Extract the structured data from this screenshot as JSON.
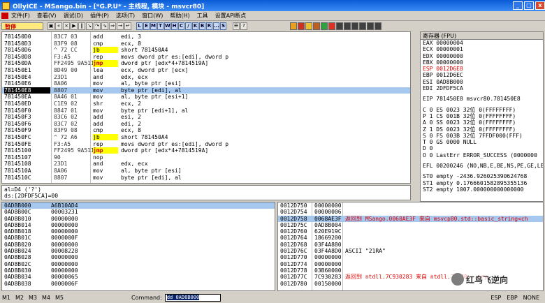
{
  "title": "OllyICE - MSango.bin - [*G.P.U* - 主线程, 模块 - msvcr80]",
  "window_buttons": [
    "_",
    "□",
    "x"
  ],
  "menu": [
    "文件(F)",
    "查看(V)",
    "调试(D)",
    "插件(P)",
    "选项(T)",
    "窗口(W)",
    "帮助(H)",
    "工具",
    "设置API断点"
  ],
  "toolbar": {
    "pause_label": "暂停",
    "letters": [
      "L",
      "E",
      "M",
      "T",
      "W",
      "H",
      "C",
      "/",
      "K",
      "B",
      "R",
      "...",
      "S"
    ]
  },
  "disasm": [
    {
      "addr": "781450D0",
      "hex": "83C7 03",
      "mnem": "add",
      "ops": "edi, 3",
      "style": ""
    },
    {
      "addr": "781450D3",
      "hex": "83F9 08",
      "mnem": "cmp",
      "ops": "ecx, 8",
      "style": ""
    },
    {
      "addr": "781450D6",
      "hex": "^ 72 CC",
      "mnem": "jb",
      "ops": "short 781450A4",
      "style": "hl"
    },
    {
      "addr": "781450D8",
      "hex": "F3:A5",
      "mnem": "rep",
      "ops": "movs dword ptr es:[edi], dword p",
      "style": ""
    },
    {
      "addr": "781450DA",
      "hex": "FF2495 9A51147",
      "mnem": "jmp",
      "ops": "dword ptr [edx*4+7814519A]",
      "style": "jmp"
    },
    {
      "addr": "781450E1",
      "hex": "8D49 00",
      "mnem": "lea",
      "ops": "ecx, dword ptr [ecx]",
      "style": ""
    },
    {
      "addr": "781450E4",
      "hex": "23D1",
      "mnem": "and",
      "ops": "edx, ecx",
      "style": ""
    },
    {
      "addr": "781450E6",
      "hex": "8A06",
      "mnem": "mov",
      "ops": "al, byte ptr [esi]",
      "style": ""
    },
    {
      "addr": "781450E8",
      "hex": "8807",
      "mnem": "mov",
      "ops": "byte ptr [edi], al",
      "style": "",
      "selected": true
    },
    {
      "addr": "781450EA",
      "hex": "8A46 01",
      "mnem": "mov",
      "ops": "al, byte ptr [esi+1]",
      "style": ""
    },
    {
      "addr": "781450ED",
      "hex": "C1E9 02",
      "mnem": "shr",
      "ops": "ecx, 2",
      "style": ""
    },
    {
      "addr": "781450F0",
      "hex": "8847 01",
      "mnem": "mov",
      "ops": "byte ptr [edi+1], al",
      "style": ""
    },
    {
      "addr": "781450F3",
      "hex": "83C6 02",
      "mnem": "add",
      "ops": "esi, 2",
      "style": ""
    },
    {
      "addr": "781450F6",
      "hex": "83C7 02",
      "mnem": "add",
      "ops": "edi, 2",
      "style": ""
    },
    {
      "addr": "781450F9",
      "hex": "83F9 08",
      "mnem": "cmp",
      "ops": "ecx, 8",
      "style": ""
    },
    {
      "addr": "781450FC",
      "hex": "^ 72 A6",
      "mnem": "jb",
      "ops": "short 781450A4",
      "style": "hl"
    },
    {
      "addr": "781450FE",
      "hex": "F3:A5",
      "mnem": "rep",
      "ops": "movs dword ptr es:[edi], dword p",
      "style": ""
    },
    {
      "addr": "78145100",
      "hex": "FF2495 9A51147",
      "mnem": "jmp",
      "ops": "dword ptr [edx*4+7814519A]",
      "style": "jmp"
    },
    {
      "addr": "78145107",
      "hex": "90",
      "mnem": "nop",
      "ops": "",
      "style": ""
    },
    {
      "addr": "78145108",
      "hex": "23D1",
      "mnem": "and",
      "ops": "edx, ecx",
      "style": ""
    },
    {
      "addr": "7814510A",
      "hex": "8A06",
      "mnem": "mov",
      "ops": "al, byte ptr [esi]",
      "style": ""
    },
    {
      "addr": "7814510C",
      "hex": "8807",
      "mnem": "mov",
      "ops": "byte ptr [edi], al",
      "style": ""
    }
  ],
  "registers": {
    "header": "寄存器 (FPU)",
    "lines": [
      {
        "t": "EAX 00000004",
        "red": false
      },
      {
        "t": "ECX 00000001",
        "red": false
      },
      {
        "t": "EDX 00000000",
        "red": false
      },
      {
        "t": "EBX 00000000",
        "red": false
      },
      {
        "t": "ESP 0012D6E8",
        "red": true
      },
      {
        "t": "EBP 0012D6EC",
        "red": false
      },
      {
        "t": "ESI 0AD8B000",
        "red": false
      },
      {
        "t": "EDI 2DFDF5CA",
        "red": false
      },
      {
        "t": "",
        "red": false,
        "gap": true
      },
      {
        "t": "EIP 781450E8 msvcr80.781450E8",
        "red": false
      },
      {
        "t": "",
        "red": false,
        "gap": true
      },
      {
        "t": "C 0  ES 0023 32位 0(FFFFFFFF)",
        "red": false
      },
      {
        "t": "P 1  CS 001B 32位 0(FFFFFFFF)",
        "red": false
      },
      {
        "t": "A 0  SS 0023 32位 0(FFFFFFFF)",
        "red": false
      },
      {
        "t": "Z 1  DS 0023 32位 0(FFFFFFFF)",
        "red": false
      },
      {
        "t": "S 0  FS 003B 32位 7FFDF000(FFF)",
        "red": false
      },
      {
        "t": "T 0  GS 0000 NULL",
        "red": false
      },
      {
        "t": "D 0",
        "red": false
      },
      {
        "t": "O 0  LastErr ERROR_SUCCESS (0000000",
        "red": false
      },
      {
        "t": "",
        "red": false,
        "gap": true
      },
      {
        "t": "EFL 00200246 (NO,NB,E,BE,NS,PE,GE,LE",
        "red": false
      },
      {
        "t": "",
        "red": false,
        "gap": true
      },
      {
        "t": "ST0 empty -2436.926025390624768",
        "red": false
      },
      {
        "t": "ST1 empty 0.1766601582895355136",
        "red": false
      },
      {
        "t": "ST2 empty 1007.000000000000000",
        "red": false
      }
    ]
  },
  "info": [
    "al=D4 ('?')",
    "ds:[2DFDF5CA]=00"
  ],
  "dump": [
    {
      "a": "0AD8B000",
      "v": "A6B10AD4",
      "sel": true
    },
    {
      "a": "0AD8B00C",
      "v": "00003231",
      "sel": false
    },
    {
      "a": "0AD8B010",
      "v": "00000000",
      "sel": false
    },
    {
      "a": "0AD8B014",
      "v": "00000000",
      "sel": false
    },
    {
      "a": "0AD8B018",
      "v": "00000000",
      "sel": false
    },
    {
      "a": "0AD8B01C",
      "v": "0000000F",
      "sel": false
    },
    {
      "a": "0AD8B020",
      "v": "00000000",
      "sel": false
    },
    {
      "a": "0AD8B024",
      "v": "00008228",
      "sel": false
    },
    {
      "a": "0AD8B028",
      "v": "00000000",
      "sel": false
    },
    {
      "a": "0AD8B02C",
      "v": "00000000",
      "sel": false
    },
    {
      "a": "0AD8B030",
      "v": "00000000",
      "sel": false
    },
    {
      "a": "0AD8B034",
      "v": "00000065",
      "sel": false
    },
    {
      "a": "0AD8B038",
      "v": "0000006F",
      "sel": false
    }
  ],
  "stack": [
    {
      "a": "0012D750",
      "v": "00000000",
      "c": "",
      "red": false,
      "sel": false
    },
    {
      "a": "0012D754",
      "v": "00000006",
      "c": "",
      "red": false,
      "sel": false
    },
    {
      "a": "0012D758",
      "v": "0068AE3F",
      "c": "返回到 MSango.0068AE3F 来自 msvcp80.std::basic_string<ch",
      "red": true,
      "sel": true
    },
    {
      "a": "0012D75C",
      "v": "0AD8B004",
      "c": "",
      "red": false,
      "sel": false
    },
    {
      "a": "0012D760",
      "v": "620E919C",
      "c": "",
      "red": false,
      "sel": false
    },
    {
      "a": "0012D764",
      "v": "18669200",
      "c": "",
      "red": false,
      "sel": false
    },
    {
      "a": "0012D768",
      "v": "03F4A880",
      "c": "",
      "red": false,
      "sel": false
    },
    {
      "a": "0012D76C",
      "v": "03F4A8D0",
      "c": "ASCII \"21RA\"",
      "red": false,
      "sel": false
    },
    {
      "a": "0012D770",
      "v": "00000000",
      "c": "",
      "red": false,
      "sel": false
    },
    {
      "a": "0012D774",
      "v": "00000000",
      "c": "",
      "red": false,
      "sel": false
    },
    {
      "a": "0012D778",
      "v": "03B60000",
      "c": "",
      "red": false,
      "sel": false
    },
    {
      "a": "0012D77C",
      "v": "7C930283",
      "c": "返回到 ntdll.7C930283 来自 ntdll.7C930...ory",
      "red": true,
      "sel": false
    },
    {
      "a": "0012D780",
      "v": "00150000",
      "c": "",
      "red": false,
      "sel": false
    }
  ],
  "status": {
    "markers": [
      "M1",
      "M2",
      "M3",
      "M4",
      "M5"
    ],
    "command_label": "Command:",
    "command_value": "dd 0AD8B000",
    "right": [
      "ESP",
      "EBP",
      "NONE"
    ]
  },
  "watermark": "红鸟飞逆向"
}
